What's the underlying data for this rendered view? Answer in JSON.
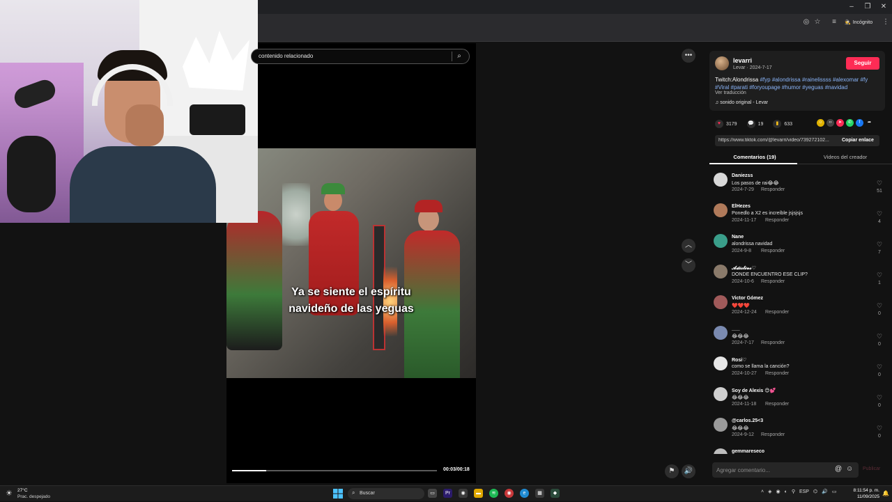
{
  "browser": {
    "incognito_label": "Incógnito",
    "window_controls": {
      "minimize": "–",
      "restore": "❐",
      "close": "✕"
    }
  },
  "player": {
    "search_text": "contenido relacionado",
    "caption_line1": "Ya se siente el espíritu",
    "caption_line2": "navideño de las yeguas",
    "time": "00:03/00:18",
    "progress": 0.1667
  },
  "post": {
    "author": "levarri",
    "author_sub": "Levar · 2024-7-17",
    "follow_label": "Seguir",
    "desc_plain": "Twitch:Alondrissa ",
    "desc_tags": "#fyp #alondrissa #rainelissss #alexomar #fy #Viral #parati #foryoupage #humor #yeguas #navidad",
    "see_translation": "Ver traducción",
    "sound": "sonido original - Levar",
    "likes": "3179",
    "comments": "19",
    "saves": "633",
    "link": "https://www.tiktok.com/@levarri/video/739272102...",
    "copy_label": "Copiar enlace",
    "tab_comments": "Comentarios (19)",
    "tab_creator": "Videos del creador"
  },
  "reply_label": "Responder",
  "comments_list": [
    {
      "name": "Daniezss",
      "text": "Los pasos de rai😂😂",
      "date": "2024-7-29",
      "likes": "51",
      "avatar": "#d8d8d8"
    },
    {
      "name": "ElHezes",
      "text": "Ponedlo a X2 es increíble jsjsjsjs",
      "date": "2024-11-17",
      "likes": "4",
      "avatar": "#b07a5a"
    },
    {
      "name": "Nane",
      "text": "alondrissa navidad",
      "date": "2024-9-8",
      "likes": "7",
      "avatar": "#3a9e8a"
    },
    {
      "name": "𝓐𝓭𝓲𝓬𝓽𝓲𝓿𝓸♡",
      "text": "DONDE ENCUENTRO ESE CLIP?",
      "date": "2024-10-6",
      "likes": "1",
      "avatar": "#8a7a6a"
    },
    {
      "name": "Victor Gómez",
      "text": "❤️❤️❤️",
      "date": "2024-12-24",
      "likes": "0",
      "avatar": "#a05a5a"
    },
    {
      "name": "___",
      "text": "😂😂😂",
      "date": "2024-7-17",
      "likes": "0",
      "avatar": "#7a8ab0"
    },
    {
      "name": "Rosi♡",
      "text": "como se llama la canción?",
      "date": "2024-10-27",
      "likes": "0",
      "avatar": "#e6e6e6"
    },
    {
      "name": "Soy de Alexis 😊💕",
      "text": "😂😂😂",
      "date": "2024-11-18",
      "likes": "0",
      "avatar": "#cfcfcf"
    },
    {
      "name": "@carlos.25<3",
      "text": "😂😂😂",
      "date": "2024-9-12",
      "likes": "0",
      "avatar": "#9a9a9a"
    },
    {
      "name": "gemmareseco",
      "text": "",
      "date": "",
      "likes": "",
      "avatar": "#bdbdbd"
    }
  ],
  "comment_placeholder": "Agregar comentario...",
  "post_label": "Publicar",
  "taskbar": {
    "temp": "27°C",
    "weather": "Prac. despejado",
    "search": "Buscar",
    "lang": "ESP",
    "time": "8:11:54 p. m.",
    "date": "11/09/2025"
  },
  "colors": {
    "accent": "#fe2c55",
    "tags": "#8ab4f8",
    "background": "#121212"
  }
}
